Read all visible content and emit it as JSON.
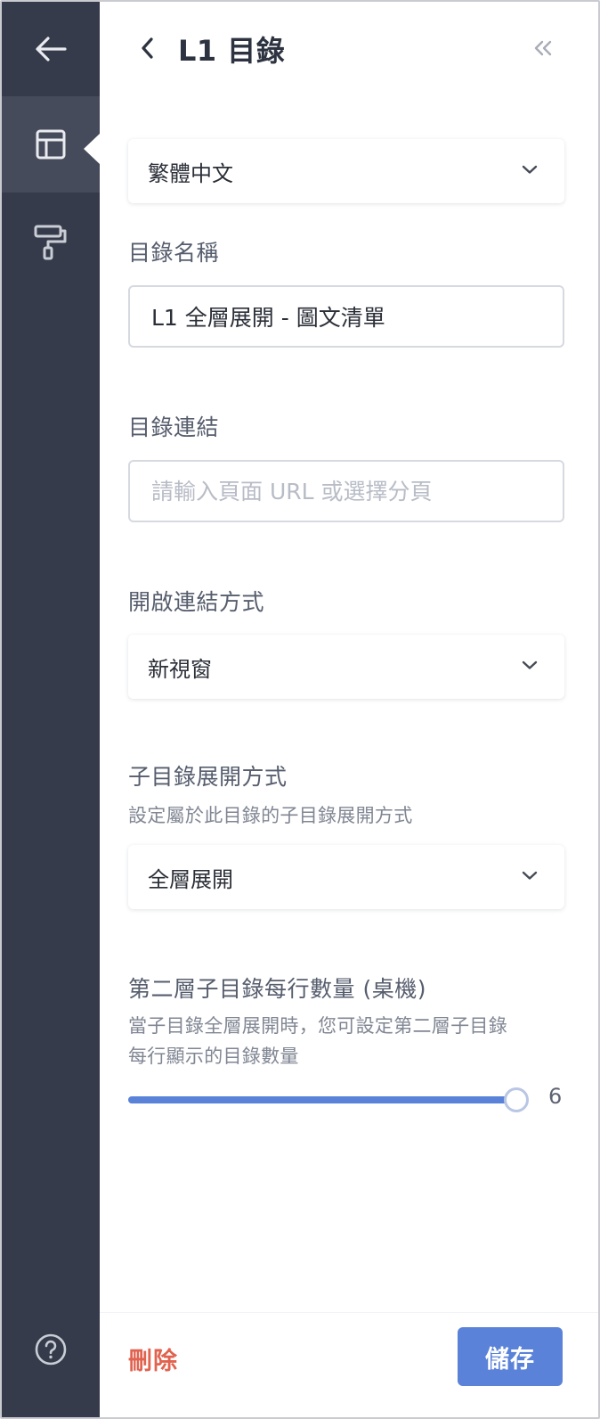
{
  "sidebar": {
    "items": [
      {
        "icon": "arrow-left-icon"
      },
      {
        "icon": "layout-icon",
        "active": true
      },
      {
        "icon": "paint-roller-icon"
      }
    ],
    "help_icon": "question-circle-icon"
  },
  "header": {
    "title": "L1 目錄"
  },
  "language_select": {
    "value": "繁體中文"
  },
  "catalog_name": {
    "label": "目錄名稱",
    "value": "L1 全層展開 - 圖文清單"
  },
  "catalog_link": {
    "label": "目錄連結",
    "placeholder": "請輸入頁面 URL 或選擇分頁"
  },
  "open_link_mode": {
    "label": "開啟連結方式",
    "value": "新視窗"
  },
  "submenu_expand": {
    "label": "子目錄展開方式",
    "help": "設定屬於此目錄的子目錄展開方式",
    "value": "全層展開"
  },
  "per_row": {
    "label": "第二層子目錄每行數量 (桌機)",
    "help_line1": "當子目錄全層展開時，您可設定第二層子目錄",
    "help_line2": "每行顯示的目錄數量",
    "value": "6",
    "fraction": 1.0
  },
  "footer": {
    "delete_label": "刪除",
    "save_label": "儲存"
  },
  "colors": {
    "sidebar": "#353b4a",
    "sidebar_active": "#454b5a",
    "accent": "#5a82d8",
    "danger": "#e0624f"
  }
}
